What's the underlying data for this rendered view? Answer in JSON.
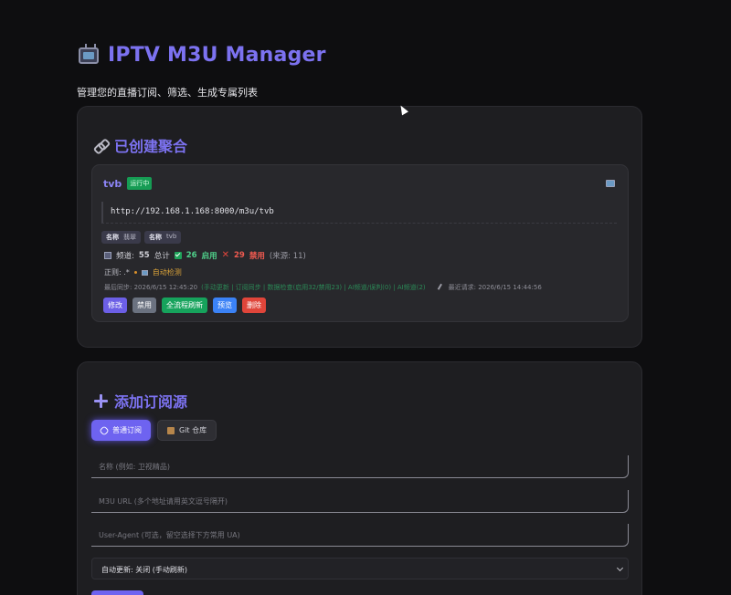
{
  "app": {
    "title": "IPTV M3U Manager",
    "subtitle": "管理您的直播订阅、筛选、生成专属列表"
  },
  "aggregations": {
    "section_title": "已创建聚合",
    "items": [
      {
        "name": "tvb",
        "status_badge": "运行中",
        "url": "http://192.168.1.168:8000/m3u/tvb",
        "tags": [
          {
            "label": "名称",
            "value": "翡翠"
          },
          {
            "label": "名称",
            "value": "tvb"
          }
        ],
        "stats": {
          "total_label": "频道:",
          "total": "55",
          "total_suffix": "总计",
          "enabled": "26",
          "enabled_suffix": "启用",
          "disabled": "29",
          "disabled_suffix": "禁用",
          "sources": "(来源: 11)"
        },
        "regex_label": "正则: .*",
        "auto_detect": "自动检测",
        "last_sync": "最后同步: 2026/6/15 12:45:20",
        "sync_details": "(手动更新 | 订阅同步 | 数据检查(启用32/禁用23) | AI频道/误判(0) | AI频道(2)",
        "last_request": "最近请求: 2026/6/15 14:44:56",
        "buttons": {
          "edit": "修改",
          "disable": "禁用",
          "refresh": "全流程刷新",
          "preview": "预览",
          "delete": "删除"
        }
      }
    ]
  },
  "add_source": {
    "section_title": "添加订阅源",
    "tabs": [
      {
        "label": "普通订阅",
        "active": true
      },
      {
        "label": "Git 仓库",
        "active": false
      }
    ],
    "name_placeholder": "名称 (例如: 卫视精品)",
    "url_placeholder": "M3U URL (多个地址请用英文逗号隔开)",
    "ua_placeholder": "User-Agent (可选，留空选择下方常用 UA)",
    "auto_update_selected": "自动更新: 关闭 (手动刷新)"
  },
  "colors": {
    "accent": "#7c72f0",
    "success": "#16a35c",
    "danger": "#e0453a",
    "info": "#3b82f6"
  }
}
